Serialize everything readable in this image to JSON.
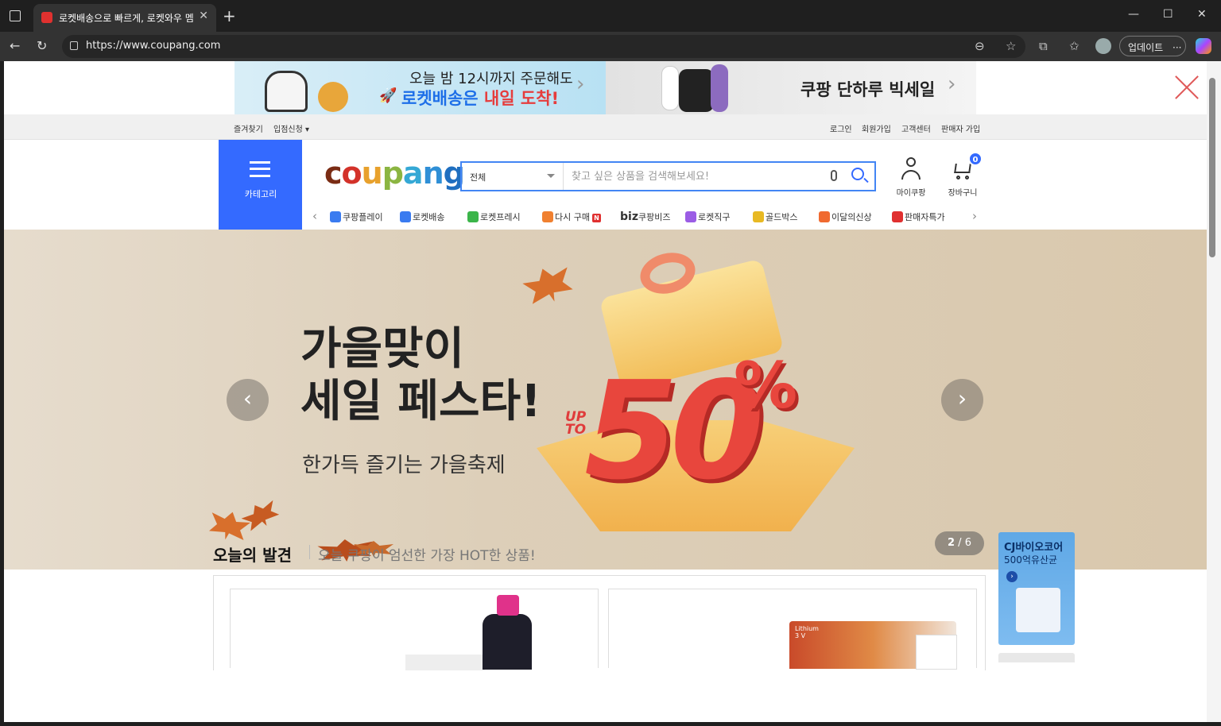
{
  "browser": {
    "tab_title": "로켓배송으로 빠르게, 로켓와우 멤",
    "url": "https://www.coupang.com",
    "update_label": "업데이트",
    "more_label": "···"
  },
  "top_banner": {
    "left_line1": "오늘 밤 12시까지 주문해도",
    "left_line2_a": "로켓배송은 ",
    "left_line2_b": "내일 도착!",
    "right_text": "쿠팡 단하루 빅세일"
  },
  "utility_bar": {
    "left": [
      "즐겨찾기",
      "입점신청 ▾"
    ],
    "right": [
      "로그인",
      "회원가입",
      "고객센터",
      "판매자 가입"
    ]
  },
  "header": {
    "category_label": "카테고리",
    "logo": [
      "c",
      "o",
      "u",
      "p",
      "a",
      "n",
      "g"
    ],
    "logo_colors": [
      "#7a2c14",
      "#d3322a",
      "#e8a12d",
      "#8bb541",
      "#35a8d5",
      "#2f8fd6",
      "#1f6fc0"
    ],
    "search": {
      "category": "전체",
      "placeholder": "찾고 싶은 상품을 검색해보세요!"
    },
    "my_coupang": "마이쿠팡",
    "cart": "장바구니",
    "cart_count": "0"
  },
  "nav": {
    "items": [
      {
        "label": "쿠팡플레이",
        "icon": "play-icon",
        "color": "#3a7bf0"
      },
      {
        "label": "로켓배송",
        "icon": "rocket-icon",
        "color": "#3a7bf0"
      },
      {
        "label": "로켓프레시",
        "icon": "rocket-fresh-icon",
        "color": "#3bb54a"
      },
      {
        "label": "다시 구매",
        "icon": "rebuy-icon",
        "color": "#f08030",
        "badge": "N"
      },
      {
        "label": "쿠팡비즈",
        "prefix": "biz",
        "icon": "biz-icon",
        "color": "#333"
      },
      {
        "label": "로켓직구",
        "icon": "global-icon",
        "color": "#9b5de5"
      },
      {
        "label": "골드박스",
        "icon": "goldbox-icon",
        "color": "#e8b923"
      },
      {
        "label": "이달의신상",
        "icon": "new-icon",
        "color": "#f06a30"
      },
      {
        "label": "판매자특가",
        "icon": "percent-icon",
        "color": "#e03030"
      }
    ]
  },
  "hero": {
    "title_line1": "가을맞이",
    "title_line2": "세일 페스타!",
    "subtitle": "한가득 즐기는 가을축제",
    "upto": "UP\nTO",
    "big_number": "50",
    "percent": "%",
    "pager_current": "2",
    "pager_total": "6"
  },
  "today": {
    "title": "오늘의 발견",
    "subtitle": "오늘 쿠팡이 엄선한 가장 HOT한 상품!"
  },
  "products": {
    "battery_label": "Lithium\n3 V"
  },
  "side_ad": {
    "line1": "CJ바이오코어",
    "line2": "500억유산균",
    "go": "›"
  }
}
